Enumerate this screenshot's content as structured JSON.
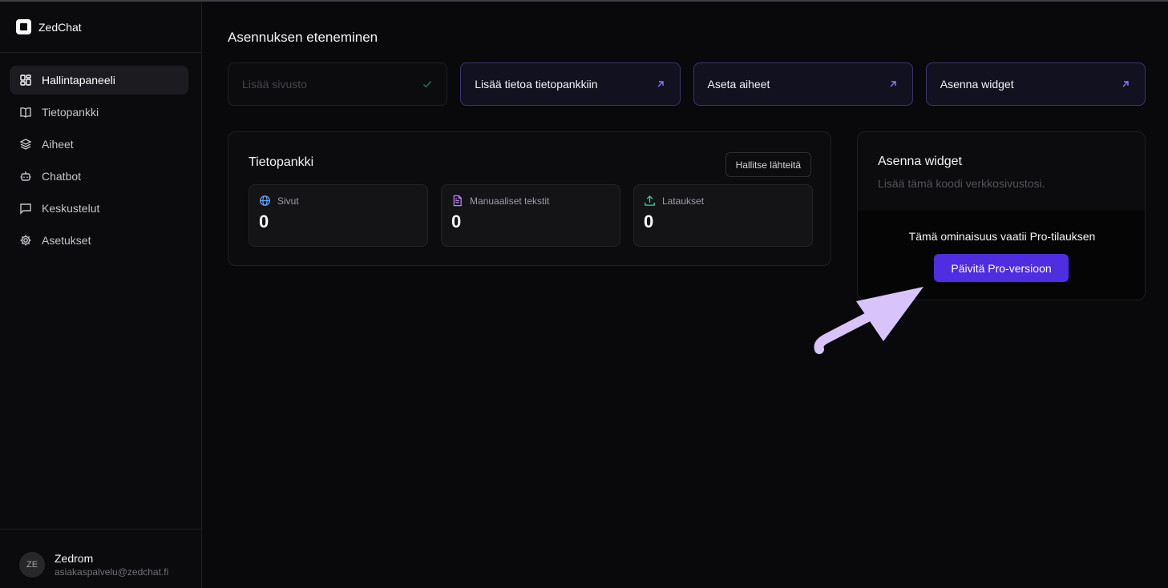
{
  "app": {
    "name": "ZedChat"
  },
  "sidebar": {
    "items": [
      {
        "label": "Hallintapaneeli",
        "icon": "dashboard-icon",
        "active": true
      },
      {
        "label": "Tietopankki",
        "icon": "book-icon"
      },
      {
        "label": "Aiheet",
        "icon": "layers-icon"
      },
      {
        "label": "Chatbot",
        "icon": "bot-icon"
      },
      {
        "label": "Keskustelut",
        "icon": "message-icon"
      },
      {
        "label": "Asetukset",
        "icon": "gear-icon"
      }
    ]
  },
  "user": {
    "initials": "ZE",
    "name": "Zedrom",
    "email": "asiakaspalvelu@zedchat.fi"
  },
  "main": {
    "title": "Asennuksen eteneminen",
    "steps": [
      {
        "label": "Lisää sivusto",
        "status": "done",
        "icon": "check-icon"
      },
      {
        "label": "Lisää tietoa tietopankkiin",
        "icon": "arrow-up-right-icon"
      },
      {
        "label": "Aseta aiheet",
        "icon": "arrow-up-right-icon"
      },
      {
        "label": "Asenna widget",
        "icon": "arrow-up-right-icon"
      }
    ]
  },
  "knowledge": {
    "title": "Tietopankki",
    "manage_label": "Hallitse lähteitä",
    "stats": [
      {
        "label": "Sivut",
        "value": "0",
        "icon": "globe-icon",
        "color": "#60a5fa"
      },
      {
        "label": "Manuaaliset tekstit",
        "value": "0",
        "icon": "document-icon",
        "color": "#c084fc"
      },
      {
        "label": "Lataukset",
        "value": "0",
        "icon": "upload-icon",
        "color": "#34d399"
      }
    ]
  },
  "widget": {
    "title": "Asenna widget",
    "description": "Lisää tämä koodi verkkosivustosi.",
    "locked_message": "Tämä ominaisuus vaatii Pro-tilauksen",
    "upgrade_label": "Päivitä Pro-versioon"
  },
  "colors": {
    "accent": "#4f2de0",
    "annotation_arrow": "#d8c4fb"
  }
}
